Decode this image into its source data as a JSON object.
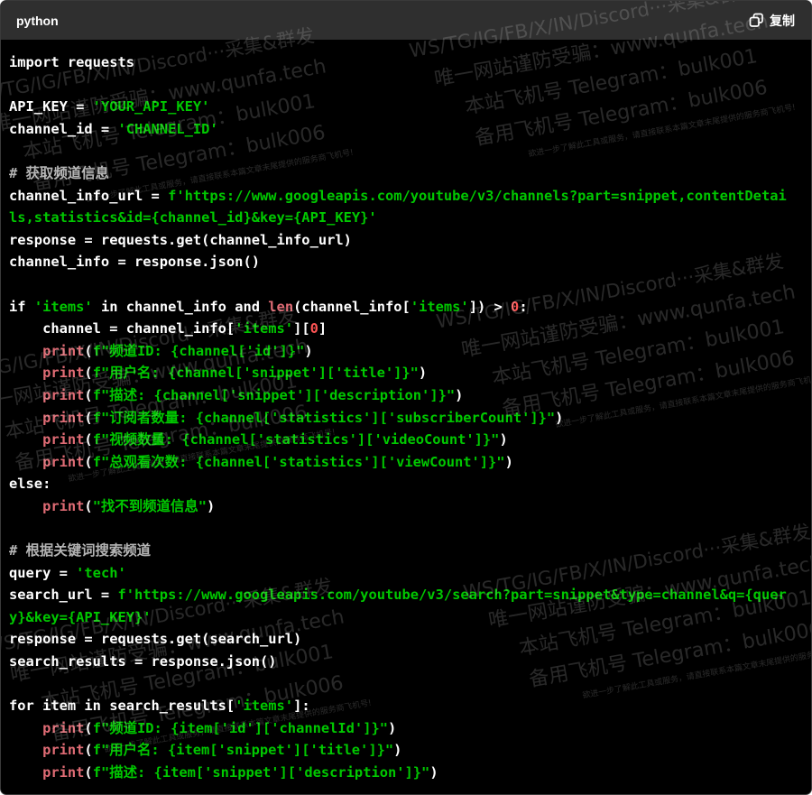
{
  "header": {
    "language": "python",
    "copy_label": "复制",
    "copy_icon": "copy-icon"
  },
  "colors": {
    "background": "#000000",
    "header_bg": "#2f2f2f",
    "string": "#00c800",
    "function": "#e06c75",
    "number": "#ff5555",
    "comment": "#b4b4b4"
  },
  "code_lines": [
    [
      {
        "t": "import requests",
        "c": "kw"
      }
    ],
    [],
    [
      {
        "t": "API_KEY = ",
        "c": "kw"
      },
      {
        "t": "'YOUR_API_KEY'",
        "c": "str"
      }
    ],
    [
      {
        "t": "channel_id = ",
        "c": "kw"
      },
      {
        "t": "'CHANNEL_ID'",
        "c": "str"
      }
    ],
    [],
    [
      {
        "t": "# 获取频道信息",
        "c": "cmt"
      }
    ],
    [
      {
        "t": "channel_info_url = ",
        "c": "kw"
      },
      {
        "t": "f'https://www.googleapis.com/youtube/v3/channels?part=snippet,contentDetai",
        "c": "str"
      }
    ],
    [
      {
        "t": "ls,statistics&id={channel_id}&key={API_KEY}'",
        "c": "str"
      }
    ],
    [
      {
        "t": "response = requests.get(channel_info_url)",
        "c": "kw"
      }
    ],
    [
      {
        "t": "channel_info = response.json()",
        "c": "kw"
      }
    ],
    [],
    [
      {
        "t": "if ",
        "c": "kw"
      },
      {
        "t": "'items'",
        "c": "str"
      },
      {
        "t": " in channel_info and ",
        "c": "kw"
      },
      {
        "t": "len",
        "c": "fn"
      },
      {
        "t": "(channel_info[",
        "c": "kw"
      },
      {
        "t": "'items'",
        "c": "str"
      },
      {
        "t": "]) > ",
        "c": "kw"
      },
      {
        "t": "0",
        "c": "num"
      },
      {
        "t": ":",
        "c": "kw"
      }
    ],
    [
      {
        "t": "    channel = channel_info[",
        "c": "kw"
      },
      {
        "t": "'items'",
        "c": "str"
      },
      {
        "t": "][",
        "c": "kw"
      },
      {
        "t": "0",
        "c": "num"
      },
      {
        "t": "]",
        "c": "kw"
      }
    ],
    [
      {
        "t": "    ",
        "c": "kw"
      },
      {
        "t": "print",
        "c": "fn"
      },
      {
        "t": "(",
        "c": "kw"
      },
      {
        "t": "f\"频道ID: {channel['id']}\"",
        "c": "str"
      },
      {
        "t": ")",
        "c": "kw"
      }
    ],
    [
      {
        "t": "    ",
        "c": "kw"
      },
      {
        "t": "print",
        "c": "fn"
      },
      {
        "t": "(",
        "c": "kw"
      },
      {
        "t": "f\"用户名: {channel['snippet']['title']}\"",
        "c": "str"
      },
      {
        "t": ")",
        "c": "kw"
      }
    ],
    [
      {
        "t": "    ",
        "c": "kw"
      },
      {
        "t": "print",
        "c": "fn"
      },
      {
        "t": "(",
        "c": "kw"
      },
      {
        "t": "f\"描述: {channel['snippet']['description']}\"",
        "c": "str"
      },
      {
        "t": ")",
        "c": "kw"
      }
    ],
    [
      {
        "t": "    ",
        "c": "kw"
      },
      {
        "t": "print",
        "c": "fn"
      },
      {
        "t": "(",
        "c": "kw"
      },
      {
        "t": "f\"订阅者数量: {channel['statistics']['subscriberCount']}\"",
        "c": "str"
      },
      {
        "t": ")",
        "c": "kw"
      }
    ],
    [
      {
        "t": "    ",
        "c": "kw"
      },
      {
        "t": "print",
        "c": "fn"
      },
      {
        "t": "(",
        "c": "kw"
      },
      {
        "t": "f\"视频数量: {channel['statistics']['videoCount']}\"",
        "c": "str"
      },
      {
        "t": ")",
        "c": "kw"
      }
    ],
    [
      {
        "t": "    ",
        "c": "kw"
      },
      {
        "t": "print",
        "c": "fn"
      },
      {
        "t": "(",
        "c": "kw"
      },
      {
        "t": "f\"总观看次数: {channel['statistics']['viewCount']}\"",
        "c": "str"
      },
      {
        "t": ")",
        "c": "kw"
      }
    ],
    [
      {
        "t": "else:",
        "c": "kw"
      }
    ],
    [
      {
        "t": "    ",
        "c": "kw"
      },
      {
        "t": "print",
        "c": "fn"
      },
      {
        "t": "(",
        "c": "kw"
      },
      {
        "t": "\"找不到频道信息\"",
        "c": "str"
      },
      {
        "t": ")",
        "c": "kw"
      }
    ],
    [],
    [
      {
        "t": "# 根据关键词搜索频道",
        "c": "cmt"
      }
    ],
    [
      {
        "t": "query = ",
        "c": "kw"
      },
      {
        "t": "'tech'",
        "c": "str"
      }
    ],
    [
      {
        "t": "search_url = ",
        "c": "kw"
      },
      {
        "t": "f'https://www.googleapis.com/youtube/v3/search?part=snippet&type=channel&q={quer",
        "c": "str"
      }
    ],
    [
      {
        "t": "y}&key={API_KEY}'",
        "c": "str"
      }
    ],
    [
      {
        "t": "response = requests.get(search_url)",
        "c": "kw"
      }
    ],
    [
      {
        "t": "search_results = response.json()",
        "c": "kw"
      }
    ],
    [],
    [
      {
        "t": "for item in search_results[",
        "c": "kw"
      },
      {
        "t": "'items'",
        "c": "str"
      },
      {
        "t": "]:",
        "c": "kw"
      }
    ],
    [
      {
        "t": "    ",
        "c": "kw"
      },
      {
        "t": "print",
        "c": "fn"
      },
      {
        "t": "(",
        "c": "kw"
      },
      {
        "t": "f\"频道ID: {item['id']['channelId']}\"",
        "c": "str"
      },
      {
        "t": ")",
        "c": "kw"
      }
    ],
    [
      {
        "t": "    ",
        "c": "kw"
      },
      {
        "t": "print",
        "c": "fn"
      },
      {
        "t": "(",
        "c": "kw"
      },
      {
        "t": "f\"用户名: {item['snippet']['title']}\"",
        "c": "str"
      },
      {
        "t": ")",
        "c": "kw"
      }
    ],
    [
      {
        "t": "    ",
        "c": "kw"
      },
      {
        "t": "print",
        "c": "fn"
      },
      {
        "t": "(",
        "c": "kw"
      },
      {
        "t": "f\"描述: {item['snippet']['description']}\"",
        "c": "str"
      },
      {
        "t": ")",
        "c": "kw"
      }
    ]
  ],
  "watermark": {
    "line1": "WS/TG/IG/FB/X/IN/Discord···采集&群发",
    "line2": "唯一网站谨防受骗：www.qunfa.tech",
    "line3": "本站飞机号 Telegram：bulk001",
    "line4": "备用飞机号 Telegram：bulk006",
    "line5": "欲进一步了解此工具或服务，请直接联系本篇文章末尾提供的服务商飞机号!"
  }
}
